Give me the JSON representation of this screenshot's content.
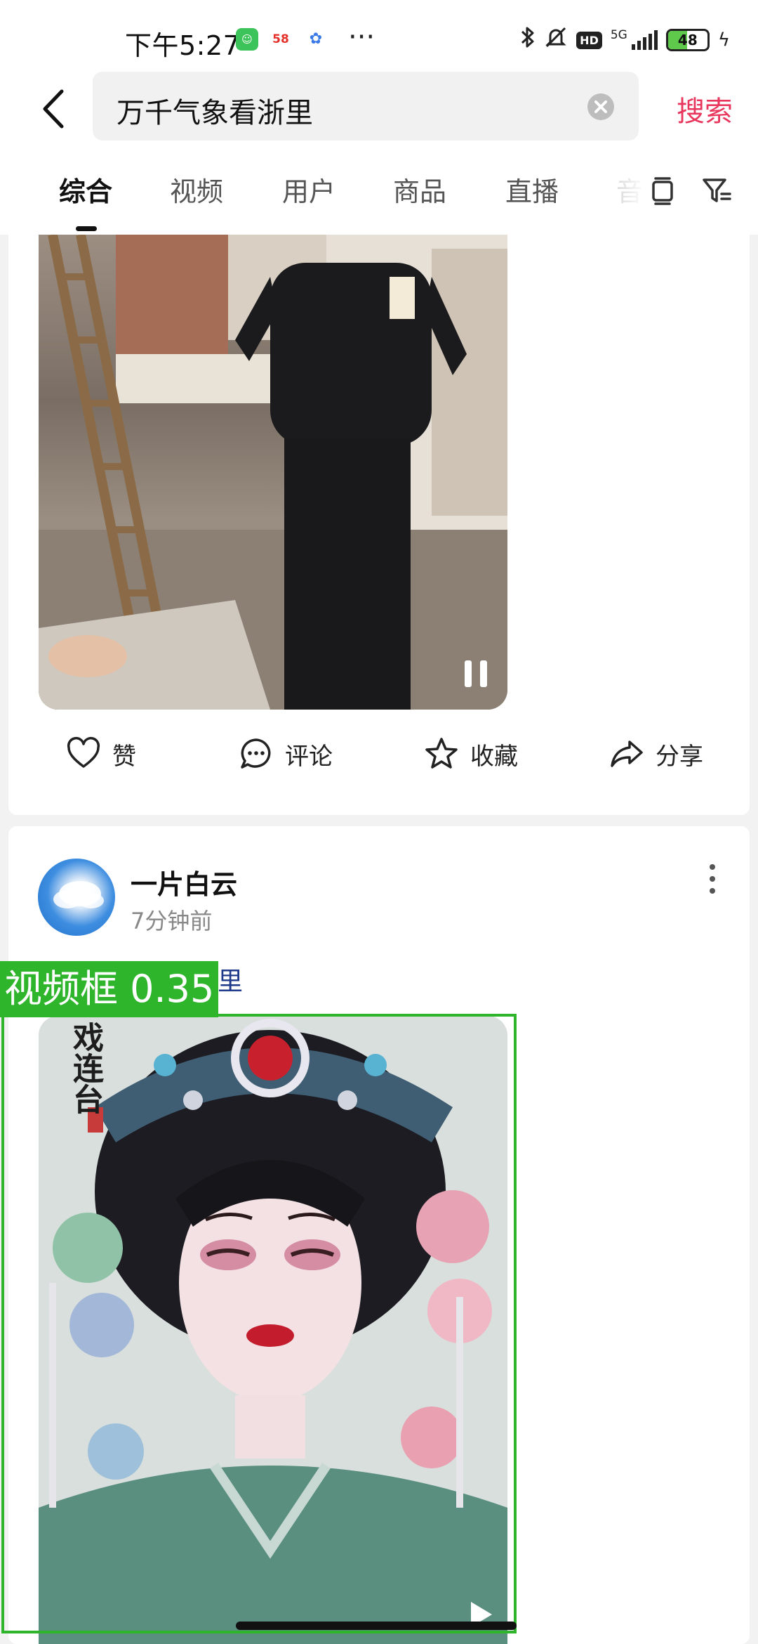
{
  "status_bar": {
    "time": "下午5:27",
    "app_icons": [
      "wechat-icon",
      "58-app-icon",
      "cloud-app-icon"
    ],
    "more": "···",
    "network": "5G",
    "hd": "HD",
    "battery": "48",
    "battery_level": 0.48
  },
  "search": {
    "query": "万千气象看浙里",
    "button_label": "搜索"
  },
  "tabs": [
    {
      "label": "综合",
      "active": true
    },
    {
      "label": "视频",
      "active": false
    },
    {
      "label": "用户",
      "active": false
    },
    {
      "label": "商品",
      "active": false
    },
    {
      "label": "直播",
      "active": false
    },
    {
      "label": "音",
      "active": false
    }
  ],
  "feed": {
    "card1": {
      "actions": {
        "like": "赞",
        "comment": "评论",
        "favorite": "收藏",
        "share": "分享"
      }
    },
    "card2": {
      "author": "一片白云",
      "time": "7分钟前",
      "text": "浙里",
      "poster_text": "戏连台"
    }
  },
  "overlay": {
    "label": "视频框 0.35"
  },
  "colors": {
    "accent": "#e8365d",
    "detection": "#2fb52b",
    "link": "#1f3a8a"
  }
}
